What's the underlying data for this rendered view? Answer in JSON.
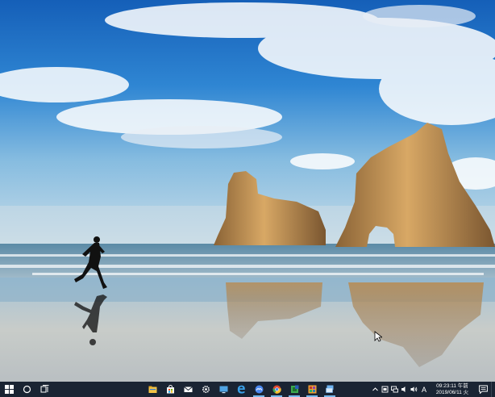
{
  "desktop": {
    "wallpaper": "Windows 10 beach wallpaper",
    "colors": {
      "sky_top": "#1d6fc4",
      "sky_bottom": "#a9cfe8",
      "rock": "#b8864e",
      "sand": "#c9c3b7"
    }
  },
  "taskbar": {
    "background": "#1a2433",
    "accent": "#76b9ed",
    "left_buttons": [
      {
        "icon": "windows-start-icon"
      },
      {
        "icon": "search-cortana-icon"
      },
      {
        "icon": "task-view-icon"
      }
    ],
    "apps": [
      {
        "icon": "file-explorer-icon",
        "color": "#f3c244",
        "running": false
      },
      {
        "icon": "store-icon",
        "color": "#f5f5f5",
        "running": false
      },
      {
        "icon": "mail-icon",
        "color": "#ffffff",
        "running": false
      },
      {
        "icon": "settings-gear-icon",
        "color": "#ffffff",
        "running": false
      },
      {
        "icon": "monitor-app-icon",
        "color": "#4fa3e3",
        "running": false
      },
      {
        "icon": "edge-icon",
        "color": "#3aa0e8",
        "running": false
      },
      {
        "icon": "baidu-netdisk-icon",
        "color": "#4b88ef",
        "running": true
      },
      {
        "icon": "chrome-icon",
        "color": "#e2482f",
        "running": true
      },
      {
        "icon": "green-app-icon",
        "color": "#3caa4f",
        "running": true
      },
      {
        "icon": "orange-app-icon",
        "color": "#f0a030",
        "running": true
      },
      {
        "icon": "remote-desktop-icon",
        "color": "#6fb3f0",
        "running": true
      }
    ],
    "tray": {
      "icons": [
        "chevron-up-icon",
        "battery-icon",
        "network-icon",
        "speaker-icon",
        "volume-icon"
      ],
      "ime": "A",
      "clock_time": "09:23:11 午前",
      "clock_date": "2019/06/11 火"
    }
  }
}
